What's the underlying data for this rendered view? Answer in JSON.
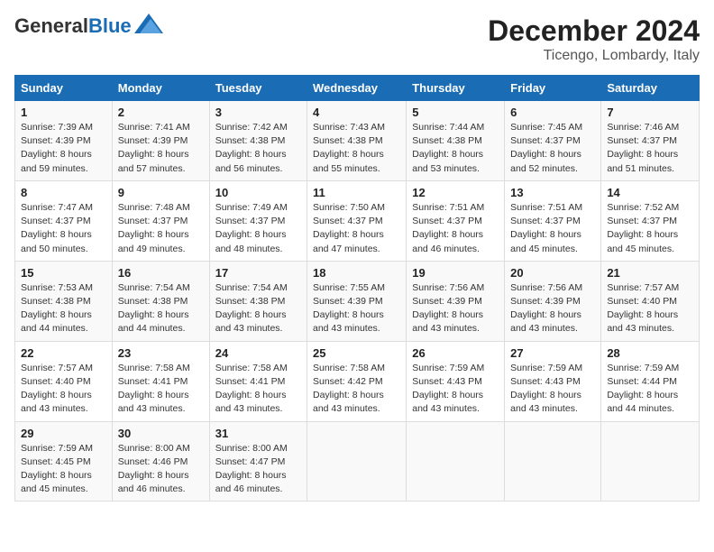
{
  "logo": {
    "general": "General",
    "blue": "Blue"
  },
  "header": {
    "month": "December 2024",
    "location": "Ticengo, Lombardy, Italy"
  },
  "weekdays": [
    "Sunday",
    "Monday",
    "Tuesday",
    "Wednesday",
    "Thursday",
    "Friday",
    "Saturday"
  ],
  "weeks": [
    [
      {
        "day": "1",
        "sunrise": "7:39 AM",
        "sunset": "4:39 PM",
        "daylight": "8 hours and 59 minutes."
      },
      {
        "day": "2",
        "sunrise": "7:41 AM",
        "sunset": "4:39 PM",
        "daylight": "8 hours and 57 minutes."
      },
      {
        "day": "3",
        "sunrise": "7:42 AM",
        "sunset": "4:38 PM",
        "daylight": "8 hours and 56 minutes."
      },
      {
        "day": "4",
        "sunrise": "7:43 AM",
        "sunset": "4:38 PM",
        "daylight": "8 hours and 55 minutes."
      },
      {
        "day": "5",
        "sunrise": "7:44 AM",
        "sunset": "4:38 PM",
        "daylight": "8 hours and 53 minutes."
      },
      {
        "day": "6",
        "sunrise": "7:45 AM",
        "sunset": "4:37 PM",
        "daylight": "8 hours and 52 minutes."
      },
      {
        "day": "7",
        "sunrise": "7:46 AM",
        "sunset": "4:37 PM",
        "daylight": "8 hours and 51 minutes."
      }
    ],
    [
      {
        "day": "8",
        "sunrise": "7:47 AM",
        "sunset": "4:37 PM",
        "daylight": "8 hours and 50 minutes."
      },
      {
        "day": "9",
        "sunrise": "7:48 AM",
        "sunset": "4:37 PM",
        "daylight": "8 hours and 49 minutes."
      },
      {
        "day": "10",
        "sunrise": "7:49 AM",
        "sunset": "4:37 PM",
        "daylight": "8 hours and 48 minutes."
      },
      {
        "day": "11",
        "sunrise": "7:50 AM",
        "sunset": "4:37 PM",
        "daylight": "8 hours and 47 minutes."
      },
      {
        "day": "12",
        "sunrise": "7:51 AM",
        "sunset": "4:37 PM",
        "daylight": "8 hours and 46 minutes."
      },
      {
        "day": "13",
        "sunrise": "7:51 AM",
        "sunset": "4:37 PM",
        "daylight": "8 hours and 45 minutes."
      },
      {
        "day": "14",
        "sunrise": "7:52 AM",
        "sunset": "4:37 PM",
        "daylight": "8 hours and 45 minutes."
      }
    ],
    [
      {
        "day": "15",
        "sunrise": "7:53 AM",
        "sunset": "4:38 PM",
        "daylight": "8 hours and 44 minutes."
      },
      {
        "day": "16",
        "sunrise": "7:54 AM",
        "sunset": "4:38 PM",
        "daylight": "8 hours and 44 minutes."
      },
      {
        "day": "17",
        "sunrise": "7:54 AM",
        "sunset": "4:38 PM",
        "daylight": "8 hours and 43 minutes."
      },
      {
        "day": "18",
        "sunrise": "7:55 AM",
        "sunset": "4:39 PM",
        "daylight": "8 hours and 43 minutes."
      },
      {
        "day": "19",
        "sunrise": "7:56 AM",
        "sunset": "4:39 PM",
        "daylight": "8 hours and 43 minutes."
      },
      {
        "day": "20",
        "sunrise": "7:56 AM",
        "sunset": "4:39 PM",
        "daylight": "8 hours and 43 minutes."
      },
      {
        "day": "21",
        "sunrise": "7:57 AM",
        "sunset": "4:40 PM",
        "daylight": "8 hours and 43 minutes."
      }
    ],
    [
      {
        "day": "22",
        "sunrise": "7:57 AM",
        "sunset": "4:40 PM",
        "daylight": "8 hours and 43 minutes."
      },
      {
        "day": "23",
        "sunrise": "7:58 AM",
        "sunset": "4:41 PM",
        "daylight": "8 hours and 43 minutes."
      },
      {
        "day": "24",
        "sunrise": "7:58 AM",
        "sunset": "4:41 PM",
        "daylight": "8 hours and 43 minutes."
      },
      {
        "day": "25",
        "sunrise": "7:58 AM",
        "sunset": "4:42 PM",
        "daylight": "8 hours and 43 minutes."
      },
      {
        "day": "26",
        "sunrise": "7:59 AM",
        "sunset": "4:43 PM",
        "daylight": "8 hours and 43 minutes."
      },
      {
        "day": "27",
        "sunrise": "7:59 AM",
        "sunset": "4:43 PM",
        "daylight": "8 hours and 43 minutes."
      },
      {
        "day": "28",
        "sunrise": "7:59 AM",
        "sunset": "4:44 PM",
        "daylight": "8 hours and 44 minutes."
      }
    ],
    [
      {
        "day": "29",
        "sunrise": "7:59 AM",
        "sunset": "4:45 PM",
        "daylight": "8 hours and 45 minutes."
      },
      {
        "day": "30",
        "sunrise": "8:00 AM",
        "sunset": "4:46 PM",
        "daylight": "8 hours and 46 minutes."
      },
      {
        "day": "31",
        "sunrise": "8:00 AM",
        "sunset": "4:47 PM",
        "daylight": "8 hours and 46 minutes."
      },
      null,
      null,
      null,
      null
    ]
  ]
}
